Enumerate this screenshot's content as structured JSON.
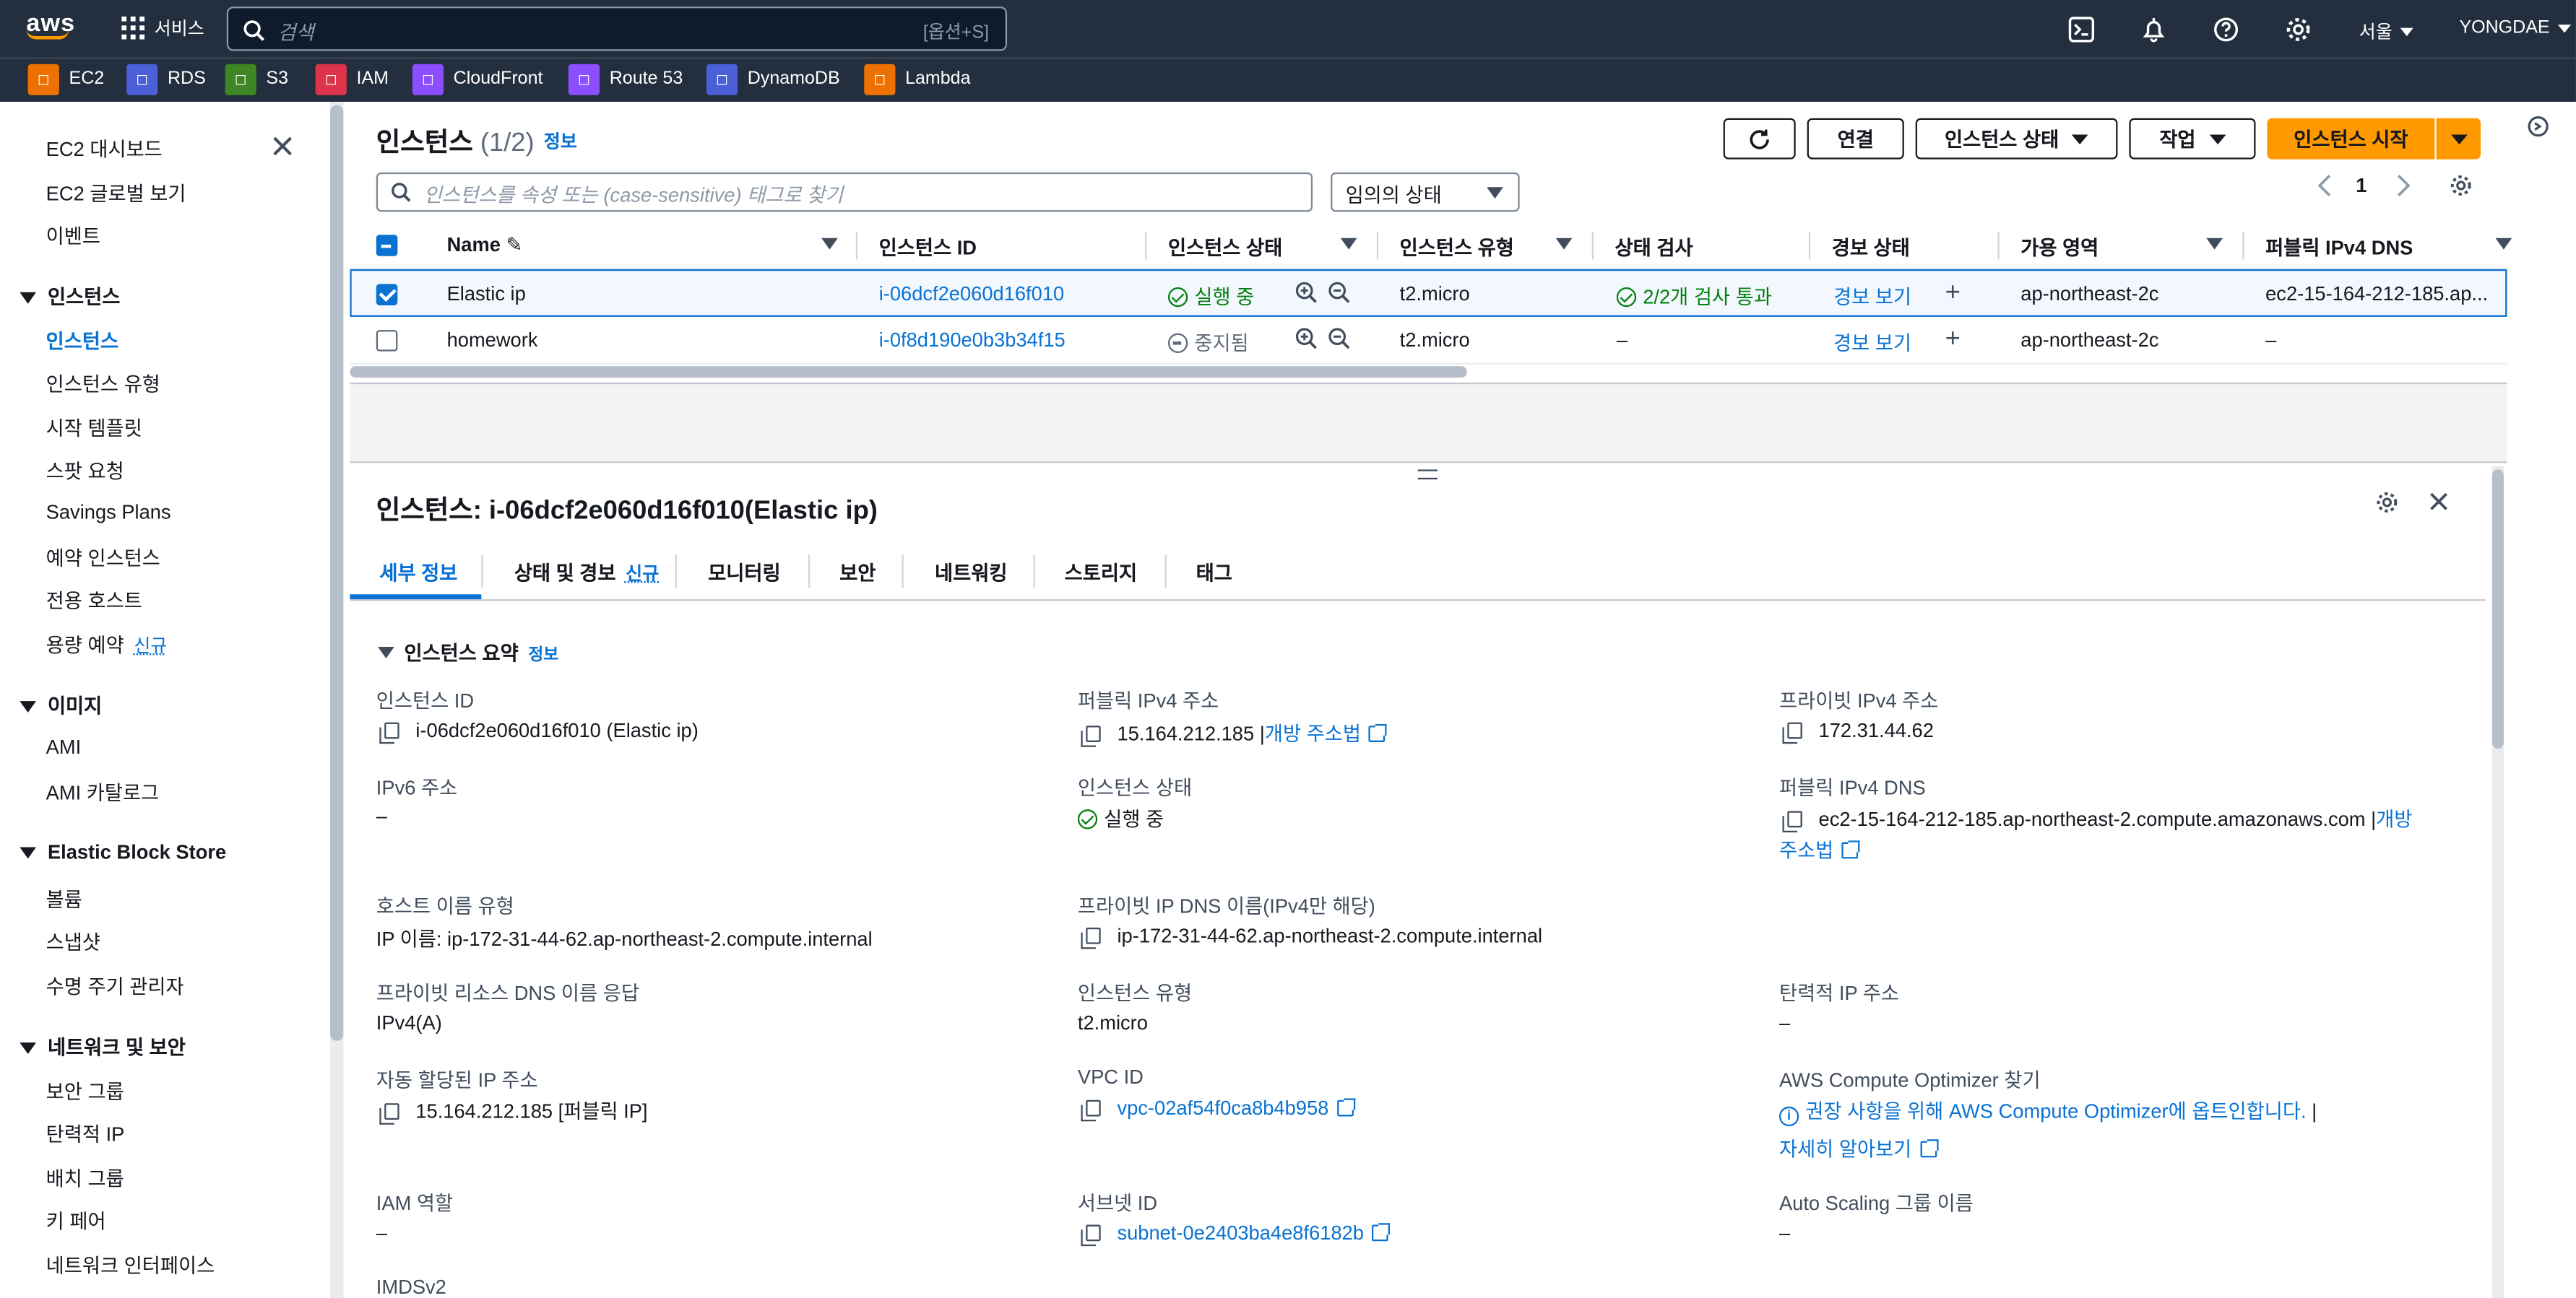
{
  "topnav": {
    "logo": "aws",
    "services_label": "서비스",
    "search_placeholder": "검색",
    "search_shortcut": "[옵션+S]",
    "region": "서울",
    "account": "YONGDAE"
  },
  "favorites": [
    {
      "label": "EC2",
      "color": "#ed7100",
      "icon": "ec2-icon"
    },
    {
      "label": "RDS",
      "color": "#4b5fd6",
      "icon": "rds-icon"
    },
    {
      "label": "S3",
      "color": "#3f8624",
      "icon": "s3-icon"
    },
    {
      "label": "IAM",
      "color": "#dd344c",
      "icon": "iam-icon"
    },
    {
      "label": "CloudFront",
      "color": "#8c4fff",
      "icon": "cloudfront-icon"
    },
    {
      "label": "Route 53",
      "color": "#8c4fff",
      "icon": "route53-icon"
    },
    {
      "label": "DynamoDB",
      "color": "#4b5fd6",
      "icon": "dynamodb-icon"
    },
    {
      "label": "Lambda",
      "color": "#ed7100",
      "icon": "lambda-icon"
    }
  ],
  "sidebar": {
    "top_items": [
      "EC2 대시보드",
      "EC2 글로벌 보기",
      "이벤트"
    ],
    "sections": [
      {
        "title": "인스턴스",
        "items": [
          "인스턴스",
          "인스턴스 유형",
          "시작 템플릿",
          "스팟 요청",
          "Savings Plans",
          "예약 인스턴스",
          "전용 호스트",
          "용량 예약"
        ]
      },
      {
        "title": "이미지",
        "items": [
          "AMI",
          "AMI 카탈로그"
        ]
      },
      {
        "title": "Elastic Block Store",
        "items": [
          "볼륨",
          "스냅샷",
          "수명 주기 관리자"
        ]
      },
      {
        "title": "네트워크 및 보안",
        "items": [
          "보안 그룹",
          "탄력적 IP",
          "배치 그룹",
          "키 페어",
          "네트워크 인터페이스"
        ]
      }
    ],
    "new_badge": "신규"
  },
  "instances": {
    "title": "인스턴스",
    "count": "(1/2)",
    "info": "정보",
    "buttons": {
      "connect": "연결",
      "state": "인스턴스 상태",
      "actions": "작업",
      "launch": "인스턴스 시작"
    },
    "search_placeholder": "인스턴스를 속성 또는 (case-sensitive) 태그로 찾기",
    "state_filter": "임의의 상태",
    "page": "1",
    "columns": [
      "Name",
      "인스턴스 ID",
      "인스턴스 상태",
      "인스턴스 유형",
      "상태 검사",
      "경보 상태",
      "가용 영역",
      "퍼블릭 IPv4 DNS"
    ],
    "rows": [
      {
        "name": "Elastic ip",
        "id": "i-06dcf2e060d16f010",
        "state": "실행 중",
        "type": "t2.micro",
        "check": "2/2개 검사 통과",
        "alarm": "경보 보기",
        "az": "ap-northeast-2c",
        "dns": "ec2-15-164-212-185.ap...",
        "selected": true
      },
      {
        "name": "homework",
        "id": "i-0f8d190e0b3b34f15",
        "state": "중지됨",
        "type": "t2.micro",
        "check": "–",
        "alarm": "경보 보기",
        "az": "ap-northeast-2c",
        "dns": "–",
        "selected": false
      }
    ]
  },
  "detail": {
    "title": "인스턴스: i-06dcf2e060d16f010(Elastic ip)",
    "tabs": [
      "세부 정보",
      "상태 및 경보",
      "모니터링",
      "보안",
      "네트워킹",
      "스토리지",
      "태그"
    ],
    "tab_new": "신규",
    "summary_title": "인스턴스 요약",
    "summary_info": "정보",
    "fields": {
      "instance_id_label": "인스턴스 ID",
      "instance_id": "i-06dcf2e060d16f010 (Elastic ip)",
      "public_ipv4_label": "퍼블릭 IPv4 주소",
      "public_ipv4": "15.164.212.185",
      "open_address": "개방 주소법",
      "private_ipv4_label": "프라이빗 IPv4 주소",
      "private_ipv4": "172.31.44.62",
      "ipv6_label": "IPv6 주소",
      "ipv6": "–",
      "state_label": "인스턴스 상태",
      "state": "실행 중",
      "public_dns_label": "퍼블릭 IPv4 DNS",
      "public_dns": "ec2-15-164-212-185.ap-northeast-2.compute.amazonaws.com",
      "open_address_2a": "개방",
      "open_address_2b": "주소법",
      "hostname_type_label": "호스트 이름 유형",
      "hostname_type": "IP 이름: ip-172-31-44-62.ap-northeast-2.compute.internal",
      "private_dns_label": "프라이빗 IP DNS 이름(IPv4만 해당)",
      "private_dns": "ip-172-31-44-62.ap-northeast-2.compute.internal",
      "private_resource_dns_label": "프라이빗 리소스 DNS 이름 응답",
      "private_resource_dns": "IPv4(A)",
      "instance_type_label": "인스턴스 유형",
      "instance_type": "t2.micro",
      "elastic_ip_label": "탄력적 IP 주소",
      "elastic_ip": "–",
      "auto_ip_label": "자동 할당된 IP 주소",
      "auto_ip": "15.164.212.185 [퍼블릭 IP]",
      "vpc_label": "VPC ID",
      "vpc": "vpc-02af54f0ca8b4b958",
      "optimizer_label": "AWS Compute Optimizer 찾기",
      "optimizer": "권장 사항을 위해 AWS Compute Optimizer에 옵트인합니다.",
      "learn_more": "자세히 알아보기",
      "iam_label": "IAM 역할",
      "iam": "–",
      "subnet_label": "서브넷 ID",
      "subnet": "subnet-0e2403ba4e8f6182b",
      "asg_label": "Auto Scaling 그룹 이름",
      "asg": "–",
      "imds_label": "IMDSv2"
    }
  }
}
